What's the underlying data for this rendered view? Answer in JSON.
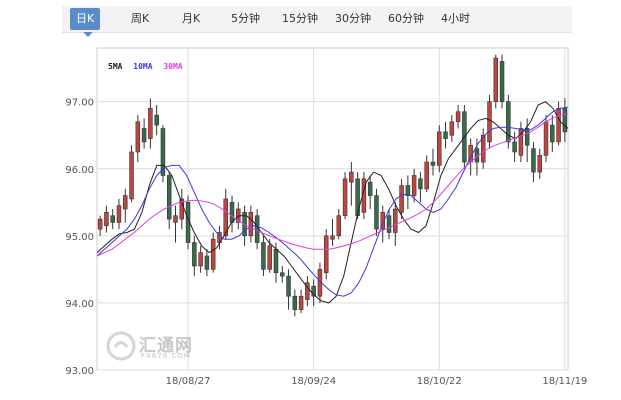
{
  "tabs": [
    {
      "label": "日K",
      "active": true
    },
    {
      "label": "周K",
      "active": false
    },
    {
      "label": "月K",
      "active": false
    },
    {
      "label": "5分钟",
      "active": false
    },
    {
      "label": "15分钟",
      "active": false
    },
    {
      "label": "30分钟",
      "active": false
    },
    {
      "label": "60分钟",
      "active": false
    },
    {
      "label": "4小时",
      "active": false
    }
  ],
  "legend": [
    {
      "label": "5MA",
      "color": "#222222"
    },
    {
      "label": "10MA",
      "color": "#3a3ae0"
    },
    {
      "label": "30MA",
      "color": "#e040e0"
    }
  ],
  "watermark": {
    "cn": "汇通网",
    "en": "FX678.COM"
  },
  "colors": {
    "up": "#c0443f",
    "down": "#3a6a4a",
    "tab_active": "#5b8bc9"
  },
  "chart_data": {
    "type": "candlestick",
    "y_ticks": [
      "97.00",
      "96.00",
      "95.00",
      "94.00",
      "93.00"
    ],
    "ylim": [
      93.0,
      97.8
    ],
    "x_ticks": [
      {
        "label": "18/08/27",
        "index": 14
      },
      {
        "label": "18/09/24",
        "index": 34
      },
      {
        "label": "18/10/22",
        "index": 54
      },
      {
        "label": "18/11/19",
        "index": 74
      }
    ],
    "series": [
      {
        "name": "5MA",
        "values": [
          94.75,
          94.85,
          94.95,
          95.03,
          95.05,
          95.1,
          95.35,
          95.75,
          96.05,
          96.05,
          95.9,
          95.6,
          95.3,
          95.05,
          94.85,
          94.75,
          94.82,
          95.0,
          95.2,
          95.3,
          95.3,
          95.2,
          95.05,
          94.9,
          94.8,
          94.7,
          94.55,
          94.4,
          94.25,
          94.12,
          94.03,
          94.0,
          94.1,
          94.4,
          94.9,
          95.4,
          95.8,
          95.95,
          95.9,
          95.7,
          95.45,
          95.25,
          95.1,
          95.05,
          95.15,
          95.5,
          95.9,
          96.15,
          96.3,
          96.45,
          96.6,
          96.72,
          96.75,
          96.7,
          96.6,
          96.5,
          96.45,
          96.55,
          96.7,
          96.95,
          97.0,
          96.9,
          96.7,
          96.6
        ]
      },
      {
        "name": "10MA",
        "values": [
          94.7,
          94.8,
          94.9,
          95.0,
          95.1,
          95.25,
          95.45,
          95.7,
          95.9,
          96.02,
          96.05,
          96.05,
          95.9,
          95.65,
          95.4,
          95.2,
          95.05,
          94.95,
          94.95,
          95.0,
          95.1,
          95.15,
          95.12,
          95.05,
          94.97,
          94.88,
          94.78,
          94.68,
          94.55,
          94.42,
          94.3,
          94.2,
          94.12,
          94.1,
          94.15,
          94.3,
          94.52,
          94.82,
          95.12,
          95.38,
          95.55,
          95.62,
          95.6,
          95.5,
          95.4,
          95.35,
          95.4,
          95.55,
          95.72,
          95.95,
          96.18,
          96.38,
          96.52,
          96.6,
          96.62,
          96.62,
          96.6,
          96.58,
          96.58,
          96.65,
          96.75,
          96.85,
          96.9,
          96.92
        ]
      },
      {
        "name": "30MA",
        "values": [
          94.7,
          94.75,
          94.8,
          94.88,
          94.97,
          95.05,
          95.15,
          95.25,
          95.33,
          95.4,
          95.45,
          95.5,
          95.52,
          95.53,
          95.52,
          95.5,
          95.45,
          95.38,
          95.3,
          95.22,
          95.15,
          95.1,
          95.05,
          95.0,
          94.96,
          94.92,
          94.88,
          94.85,
          94.82,
          94.8,
          94.8,
          94.8,
          94.82,
          94.85,
          94.88,
          94.92,
          94.97,
          95.02,
          95.07,
          95.12,
          95.17,
          95.22,
          95.27,
          95.33,
          95.4,
          95.5,
          95.62,
          95.75,
          95.88,
          96.0,
          96.1,
          96.2,
          96.28,
          96.34,
          96.38,
          96.42,
          96.46,
          96.5,
          96.55,
          96.62,
          96.7,
          96.76,
          96.8,
          96.82
        ]
      }
    ],
    "candles": [
      [
        95.1,
        95.25,
        95.0,
        95.3
      ],
      [
        95.15,
        95.35,
        95.05,
        95.45
      ],
      [
        95.3,
        95.2,
        95.1,
        95.4
      ],
      [
        95.2,
        95.45,
        95.1,
        95.55
      ],
      [
        95.4,
        95.6,
        95.2,
        95.7
      ],
      [
        95.55,
        96.25,
        95.5,
        96.35
      ],
      [
        96.25,
        96.7,
        96.1,
        96.8
      ],
      [
        96.6,
        96.4,
        96.3,
        96.75
      ],
      [
        96.45,
        96.9,
        96.3,
        97.05
      ],
      [
        96.8,
        96.65,
        96.5,
        96.95
      ],
      [
        96.6,
        95.9,
        95.8,
        96.65
      ],
      [
        95.9,
        95.25,
        95.1,
        95.95
      ],
      [
        95.2,
        95.3,
        94.9,
        95.45
      ],
      [
        95.25,
        95.55,
        95.1,
        95.7
      ],
      [
        95.5,
        94.9,
        94.8,
        95.6
      ],
      [
        94.9,
        94.55,
        94.4,
        95.0
      ],
      [
        94.55,
        94.75,
        94.45,
        94.85
      ],
      [
        94.7,
        94.5,
        94.4,
        94.8
      ],
      [
        94.5,
        94.95,
        94.45,
        95.05
      ],
      [
        94.9,
        95.05,
        94.8,
        95.15
      ],
      [
        95.0,
        95.55,
        94.95,
        95.7
      ],
      [
        95.5,
        95.2,
        95.05,
        95.6
      ],
      [
        95.2,
        95.4,
        95.1,
        95.5
      ],
      [
        95.35,
        95.0,
        94.85,
        95.45
      ],
      [
        95.0,
        95.35,
        94.9,
        95.45
      ],
      [
        95.3,
        94.9,
        94.8,
        95.4
      ],
      [
        94.9,
        94.5,
        94.4,
        95.0
      ],
      [
        94.5,
        94.85,
        94.45,
        94.95
      ],
      [
        94.8,
        94.45,
        94.3,
        94.9
      ],
      [
        94.45,
        94.4,
        94.3,
        94.55
      ],
      [
        94.4,
        94.1,
        93.9,
        94.5
      ],
      [
        94.1,
        93.9,
        93.8,
        94.2
      ],
      [
        93.9,
        94.1,
        93.85,
        94.2
      ],
      [
        94.05,
        94.3,
        93.95,
        94.4
      ],
      [
        94.25,
        94.1,
        93.95,
        94.35
      ],
      [
        94.1,
        94.5,
        94.0,
        94.6
      ],
      [
        94.45,
        95.0,
        94.35,
        95.1
      ],
      [
        94.95,
        95.0,
        94.85,
        95.25
      ],
      [
        95.0,
        95.3,
        94.95,
        95.4
      ],
      [
        95.3,
        95.85,
        95.25,
        95.95
      ],
      [
        95.8,
        95.95,
        95.45,
        96.1
      ],
      [
        95.85,
        95.3,
        95.25,
        95.95
      ],
      [
        95.35,
        95.85,
        95.25,
        95.95
      ],
      [
        95.8,
        95.6,
        95.4,
        95.9
      ],
      [
        95.6,
        95.1,
        95.0,
        95.7
      ],
      [
        95.1,
        95.35,
        94.9,
        95.45
      ],
      [
        95.3,
        95.05,
        94.95,
        95.4
      ],
      [
        95.05,
        95.4,
        94.85,
        95.5
      ],
      [
        95.35,
        95.75,
        95.25,
        95.85
      ],
      [
        95.75,
        95.6,
        95.4,
        95.9
      ],
      [
        95.6,
        95.9,
        95.5,
        96.0
      ],
      [
        95.85,
        95.7,
        95.5,
        95.95
      ],
      [
        95.7,
        96.1,
        95.65,
        96.2
      ],
      [
        96.1,
        96.05,
        95.9,
        96.3
      ],
      [
        96.05,
        96.55,
        95.95,
        96.65
      ],
      [
        96.55,
        96.45,
        96.3,
        96.7
      ],
      [
        96.5,
        96.7,
        96.4,
        96.8
      ],
      [
        96.7,
        96.85,
        96.6,
        96.95
      ],
      [
        96.85,
        96.1,
        96.0,
        96.95
      ],
      [
        96.1,
        96.35,
        95.9,
        96.45
      ],
      [
        96.3,
        96.1,
        95.9,
        96.45
      ],
      [
        96.1,
        96.5,
        96.0,
        96.6
      ],
      [
        96.4,
        97.0,
        96.3,
        97.1
      ],
      [
        97.0,
        97.65,
        96.9,
        97.7
      ],
      [
        97.6,
        97.0,
        96.9,
        97.7
      ],
      [
        97.0,
        96.4,
        96.3,
        97.1
      ],
      [
        96.4,
        96.25,
        96.1,
        96.55
      ],
      [
        96.2,
        96.6,
        96.1,
        96.7
      ],
      [
        96.6,
        96.35,
        96.1,
        96.75
      ],
      [
        96.3,
        95.95,
        95.8,
        96.4
      ],
      [
        95.95,
        96.2,
        95.85,
        96.3
      ],
      [
        96.2,
        96.7,
        96.1,
        96.8
      ],
      [
        96.65,
        96.4,
        96.25,
        96.8
      ],
      [
        96.4,
        96.9,
        96.35,
        97.0
      ],
      [
        96.9,
        96.55,
        96.4,
        97.05
      ]
    ]
  }
}
